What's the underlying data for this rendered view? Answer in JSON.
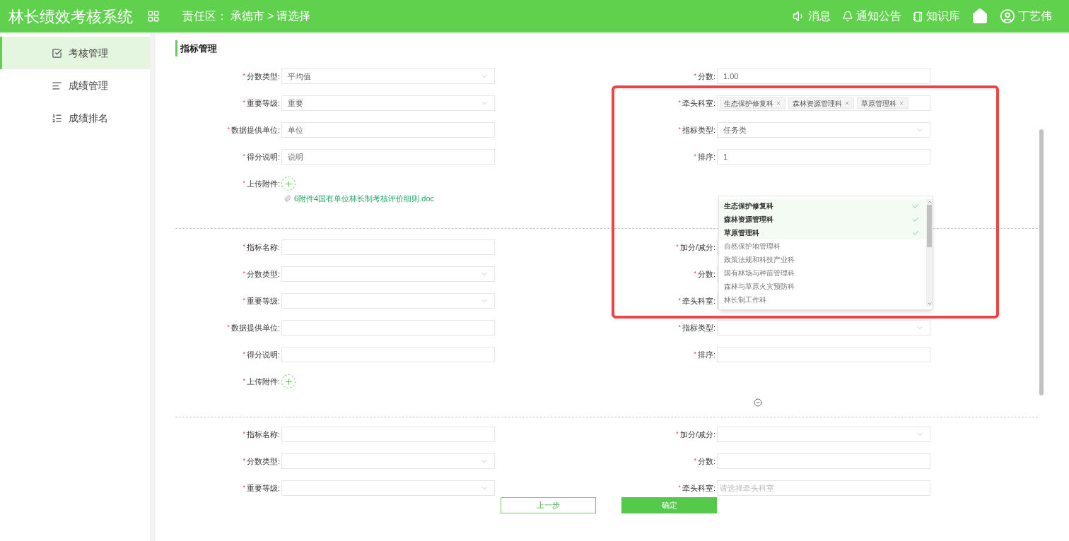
{
  "header": {
    "title": "林长绩效考核系统",
    "breadcrumb": {
      "label": "责任区：",
      "city": "承德市",
      "separator": ">",
      "area": "请选择"
    },
    "nav": [
      {
        "kind": "speaker",
        "label": "消息"
      },
      {
        "kind": "bell",
        "label": "通知公告"
      },
      {
        "kind": "book",
        "label": "知识库"
      },
      {
        "kind": "home"
      },
      {
        "kind": "user",
        "label": "丁艺伟"
      }
    ]
  },
  "sidebar": {
    "items": [
      {
        "kind": "form",
        "label": "考核管理",
        "selected": true
      },
      {
        "kind": "bars",
        "label": "成绩管理",
        "selected": false
      },
      {
        "kind": "ranking",
        "label": "成绩排名",
        "selected": false
      }
    ]
  },
  "section_title": "指标管理",
  "required_mark": "*",
  "groups": [
    {
      "removable": false,
      "left": [
        {
          "kind": "select",
          "label": "分数类型:",
          "required": true,
          "value": "平均值"
        },
        {
          "kind": "select",
          "label": "重要等级:",
          "required": true,
          "value": "重要"
        },
        {
          "kind": "text",
          "label": "数据提供单位:",
          "required": true,
          "value": "单位"
        },
        {
          "kind": "text",
          "label": "得分说明:",
          "required": true,
          "value": "说明"
        },
        {
          "kind": "upload",
          "label": "上传附件:",
          "required": true,
          "attachment": "6附件4国有单位林长制考核评价细则.doc"
        }
      ],
      "right": [
        {
          "kind": "text",
          "label": "分数:",
          "required": true,
          "value": "1.00"
        },
        {
          "kind": "tags",
          "label": "牵头科室:",
          "required": true,
          "tags": [
            "生态保护修复科",
            "森林资源管理科",
            "草原管理科"
          ]
        },
        {
          "kind": "select",
          "label": "指标类型:",
          "required": true,
          "value": "任务类"
        },
        {
          "kind": "text",
          "label": "排序:",
          "required": true,
          "value": "1"
        }
      ]
    },
    {
      "removable": true,
      "left": [
        {
          "kind": "text",
          "label": "指标名称:",
          "required": true
        },
        {
          "kind": "select",
          "label": "分数类型:",
          "required": true
        },
        {
          "kind": "select",
          "label": "重要等级:",
          "required": true
        },
        {
          "kind": "text",
          "label": "数据提供单位:",
          "required": true
        },
        {
          "kind": "text",
          "label": "得分说明:",
          "required": true
        },
        {
          "kind": "upload",
          "label": "上传附件:",
          "required": true
        }
      ],
      "right": [
        {
          "kind": "select",
          "label": "加分/减分:",
          "required": true
        },
        {
          "kind": "text",
          "label": "分数:",
          "required": true
        },
        {
          "kind": "tags",
          "label": "牵头科室:",
          "required": true
        },
        {
          "kind": "select",
          "label": "指标类型:",
          "required": true
        },
        {
          "kind": "text",
          "label": "排序:",
          "required": true
        }
      ]
    },
    {
      "removable": false,
      "left": [
        {
          "kind": "text",
          "label": "指标名称:",
          "required": true
        },
        {
          "kind": "select",
          "label": "分数类型:",
          "required": true
        },
        {
          "kind": "select",
          "label": "重要等级:",
          "required": true
        }
      ],
      "right": [
        {
          "kind": "select",
          "label": "加分/减分:",
          "required": true
        },
        {
          "kind": "text",
          "label": "分数:",
          "required": true
        },
        {
          "kind": "tags",
          "label": "牵头科室:",
          "required": true,
          "placeholder": "请选择牵头科室"
        }
      ]
    }
  ],
  "dropdown": {
    "options": [
      {
        "label": "生态保护修复科",
        "selected": true
      },
      {
        "label": "森林资源管理科",
        "selected": true
      },
      {
        "label": "草原管理科",
        "selected": true
      },
      {
        "label": "自然保护地管理科",
        "selected": false
      },
      {
        "label": "政策法规和科技产业科",
        "selected": false
      },
      {
        "label": "国有林场与种苗管理科",
        "selected": false
      },
      {
        "label": "森林与草原火灾预防科",
        "selected": false
      },
      {
        "label": "林长制工作科",
        "selected": false
      }
    ]
  },
  "buttons": [
    {
      "kind": "secondary",
      "label": "上一步"
    },
    {
      "kind": "primary",
      "label": "确定"
    }
  ]
}
